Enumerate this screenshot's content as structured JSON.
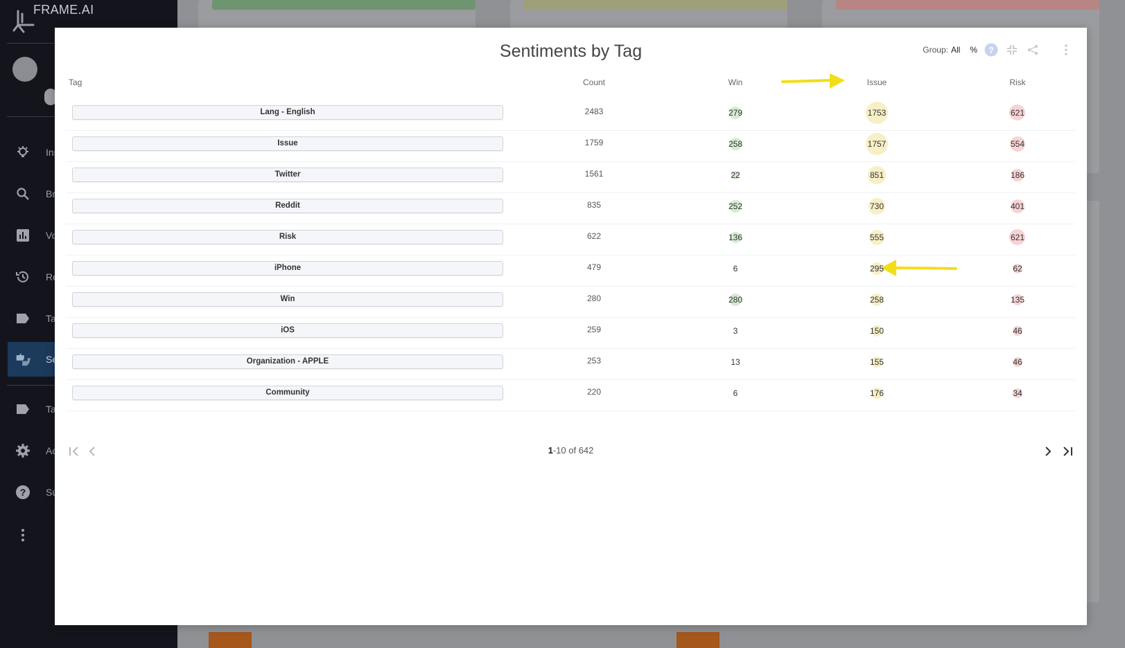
{
  "app": {
    "brand": "FRAME.AI"
  },
  "sidebar": {
    "items": [
      {
        "icon": "bulb-icon",
        "label": "Ins"
      },
      {
        "icon": "search-icon",
        "label": "Br"
      },
      {
        "icon": "bar-chart-icon",
        "label": "Vo"
      },
      {
        "icon": "history-icon",
        "label": "Re"
      },
      {
        "icon": "tag-icon",
        "label": "Ta"
      },
      {
        "icon": "thumbs-icon",
        "label": "Se"
      },
      {
        "icon": "tag-icon",
        "label": "Ta"
      },
      {
        "icon": "gear-icon",
        "label": "Ac"
      },
      {
        "icon": "help-icon",
        "label": "Su"
      }
    ]
  },
  "modal": {
    "title": "Sentiments by Tag",
    "group_label": "Group:",
    "group_value": "All",
    "percent_toggle": "%",
    "columns": {
      "tag": "Tag",
      "count": "Count",
      "win": "Win",
      "issue": "Issue",
      "risk": "Risk"
    },
    "rows": [
      {
        "tag": "Lang - English",
        "count": "2483",
        "win": "279",
        "issue": "1753",
        "risk": "621"
      },
      {
        "tag": "Issue",
        "count": "1759",
        "win": "258",
        "issue": "1757",
        "risk": "554"
      },
      {
        "tag": "Twitter",
        "count": "1561",
        "win": "22",
        "issue": "851",
        "risk": "186"
      },
      {
        "tag": "Reddit",
        "count": "835",
        "win": "252",
        "issue": "730",
        "risk": "401"
      },
      {
        "tag": "Risk",
        "count": "622",
        "win": "136",
        "issue": "555",
        "risk": "621"
      },
      {
        "tag": "iPhone",
        "count": "479",
        "win": "6",
        "issue": "295",
        "risk": "62"
      },
      {
        "tag": "Win",
        "count": "280",
        "win": "280",
        "issue": "258",
        "risk": "135"
      },
      {
        "tag": "iOS",
        "count": "259",
        "win": "3",
        "issue": "150",
        "risk": "46"
      },
      {
        "tag": "Organization - APPLE",
        "count": "253",
        "win": "13",
        "issue": "155",
        "risk": "46"
      },
      {
        "tag": "Community",
        "count": "220",
        "win": "6",
        "issue": "176",
        "risk": "34"
      }
    ],
    "pagination": {
      "range": "1",
      "range_rest": "-10 of 642"
    }
  },
  "colors": {
    "win": "#d4ecd0",
    "issue": "#f7efc6",
    "risk": "#f8d3d3",
    "arrow": "#f2dd1a"
  }
}
